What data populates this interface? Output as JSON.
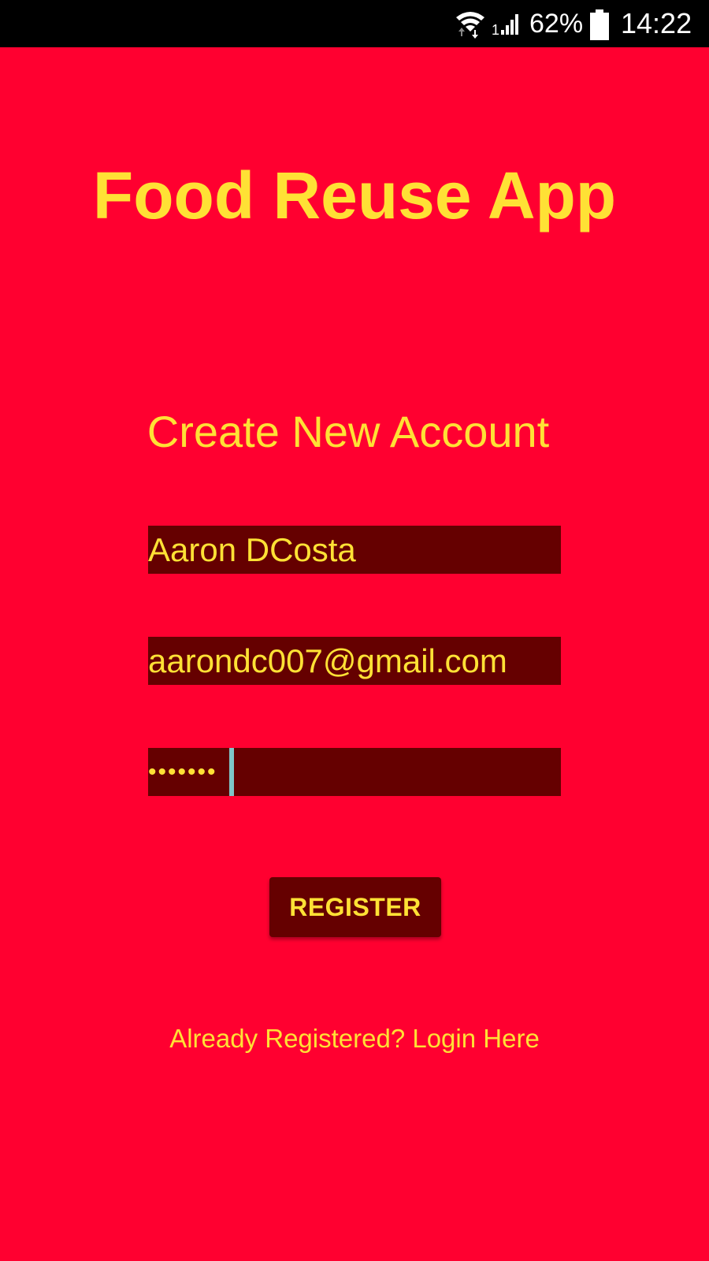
{
  "status_bar": {
    "battery_percent": "62%",
    "time": "14:22",
    "icons": [
      "wifi-icon",
      "signal-icon",
      "battery-icon"
    ]
  },
  "app": {
    "title": "Food Reuse App"
  },
  "form": {
    "heading": "Create New Account",
    "name_value": "Aaron DCosta",
    "email_value": "aarondc007@gmail.com",
    "password_mask": "•••••••",
    "register_label": "REGISTER",
    "login_link": "Already Registered? Login Here"
  },
  "colors": {
    "background": "#FF0030",
    "accent_text": "#FFE135",
    "field_background": "#650000",
    "caret": "#7FC6C8"
  }
}
